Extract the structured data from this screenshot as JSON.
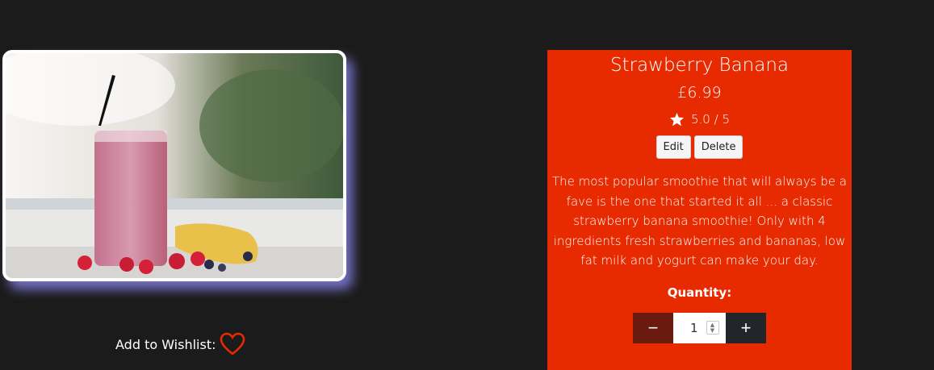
{
  "product": {
    "name": "Strawberry Banana",
    "price": "£6.99",
    "rating": "5.0 / 5",
    "description": "The most popular smoothie that will always be a fave is the one that started it all ... a classic strawberry banana smoothie! Only with 4 ingredients fresh strawberries and bananas, low fat milk and yogurt can make your day.",
    "image_icon": "smoothie-photo"
  },
  "actions": {
    "edit_label": "Edit",
    "delete_label": "Delete"
  },
  "quantity": {
    "label": "Quantity:",
    "value": "1",
    "minus_symbol": "−",
    "plus_symbol": "+"
  },
  "wishlist": {
    "label": "Add to Wishlist:",
    "icon": "heart-icon"
  },
  "colors": {
    "page_background": "#1b1b1b",
    "panel_background": "#e82a00",
    "heart": "#e82a00",
    "image_glow": "#968cff"
  }
}
